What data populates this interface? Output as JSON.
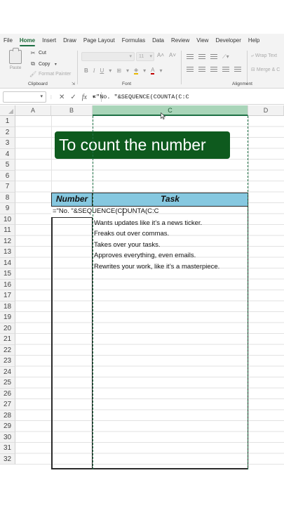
{
  "ribbon": {
    "tabs": [
      "File",
      "Home",
      "Insert",
      "Draw",
      "Page Layout",
      "Formulas",
      "Data",
      "Review",
      "View",
      "Developer",
      "Help"
    ],
    "active_tab": "Home",
    "clipboard": {
      "paste": "Paste",
      "cut": "Cut",
      "copy": "Copy",
      "format_painter": "Format Painter",
      "group_label": "Clipboard"
    },
    "font": {
      "size": "11",
      "group_label": "Font"
    },
    "alignment": {
      "wrap_text": "Wrap Text",
      "merge_center": "Merge & C",
      "group_label": "Alignment"
    }
  },
  "formula_bar": {
    "formula": "=\"No. \"&SEQUENCE(COUNTA(C:C"
  },
  "grid": {
    "columns": [
      "A",
      "B",
      "C",
      "D"
    ],
    "selected_column": "C",
    "rows": [
      "1",
      "2",
      "3",
      "4",
      "5",
      "6",
      "7",
      "8",
      "9",
      "10",
      "11",
      "12",
      "13",
      "14",
      "15",
      "16",
      "17",
      "18",
      "19",
      "20",
      "21",
      "22",
      "23",
      "24",
      "25",
      "26",
      "27",
      "28",
      "29",
      "30",
      "31",
      "32"
    ],
    "title_text": "To count the number",
    "table_headers": {
      "number": "Number",
      "task": "Task"
    },
    "editing_cell": "=\"No. \"&SEQUENCE(COUNTA(C:C",
    "tasks": [
      "Wants updates like it’s a news ticker.",
      "Freaks out over commas.",
      "Takes over your tasks.",
      "Approves everything, even emails.",
      "Rewrites your work, like it’s a masterpiece."
    ]
  },
  "colors": {
    "accent": "#1e7145",
    "title_bg": "#0e5a1e",
    "header_bg": "#86c8e0"
  }
}
